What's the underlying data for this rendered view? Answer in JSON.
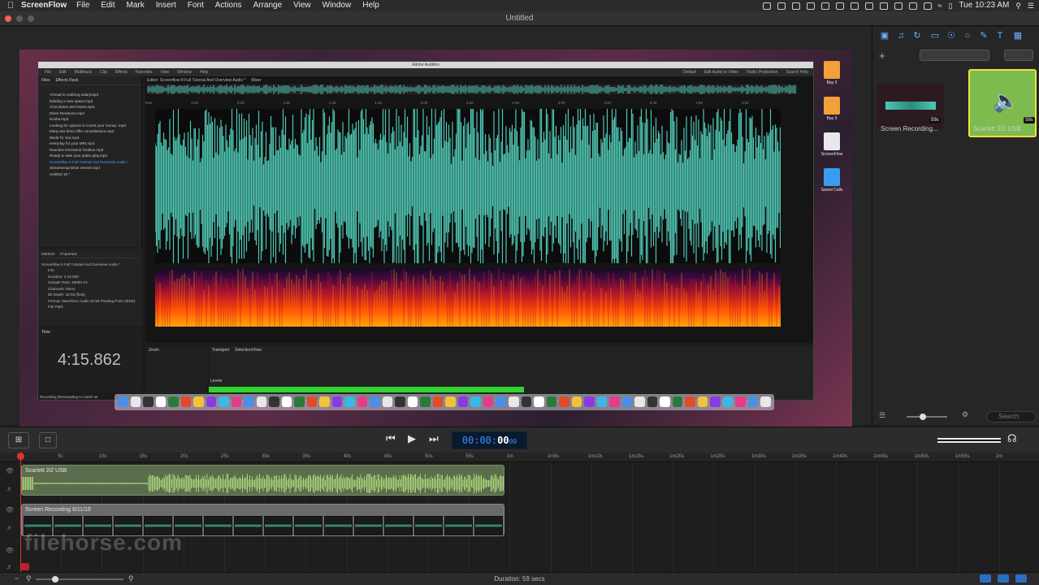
{
  "menubar": {
    "app_name": "ScreenFlow",
    "items": [
      "File",
      "Edit",
      "Mark",
      "Insert",
      "Font",
      "Actions",
      "Arrange",
      "View",
      "Window",
      "Help"
    ],
    "clock": "Tue 10:23 AM"
  },
  "window": {
    "title": "Untitled"
  },
  "recording": {
    "audition": {
      "app_title": "Adobe Audition",
      "menus": [
        "File",
        "Edit",
        "Multitrack",
        "Clip",
        "Effects",
        "Favorites",
        "View",
        "Window",
        "Help"
      ],
      "panel_files": "Files",
      "panel_effects": "Effects Rack",
      "editor_tab": "Editor: Screenflow 8 Full Tutorial And Overview Audio *",
      "mixer_tab": "Mixer",
      "workspace_items": [
        "Default",
        "Edit Audio to Video",
        "Radio Production"
      ],
      "search_placeholder": "Search Help",
      "files": [
        "Ahmad is realizing salarymp3",
        "building a new space.mp3",
        "Chocolates and Notes.mp3",
        "Elsen Revisions.mp3",
        "Knobs.mp3",
        "Looking for options to invest your money .mp3",
        "Many law firms offer consultations.mp3",
        "Meds To You.mp3",
        "everyday for your MRI.mp3",
        "Reactive Decisions Toolbox.mp3",
        "Ready to take your poker play.mp3",
        "Screenflow 8 Full Tutorial And Overview Audio *",
        "Streamwrap Brick Veneer.mp3",
        "Untitled 16 *"
      ],
      "active_file_index": 11,
      "properties_tabs": [
        "Markers",
        "Properties"
      ],
      "properties_file": "Screenflow 8 Full Tutorial And Overview Audio *",
      "properties": [
        "Info",
        "Duration: 4:15.862",
        "Sample Rate: 48000 Hz",
        "Channels: Mono",
        "Bit Depth: 32-bit (float)",
        "Format: Waveform Audio 32-bit Floating Point (IEEE)",
        "File Path:"
      ],
      "time_panel": "Time",
      "time_display": "4:15.862",
      "zoom_panel": "Zoom",
      "transport_tab": "Transport",
      "selection_tab": "Selection/View",
      "levels_label": "Levels",
      "status_left": "Recording (Resampling to match se",
      "ruler_ticks": [
        "hms",
        "0:20",
        "0:40",
        "1:00",
        "1:20",
        "1:40",
        "2:00",
        "2:20",
        "2:40",
        "3:00",
        "3:20",
        "3:40",
        "4:00",
        "4:20"
      ]
    },
    "desktop_icons": [
      "Bay 2",
      "Bay 3",
      "ScreenFlow",
      "Saved Calls"
    ]
  },
  "inspector": {
    "clips": [
      {
        "label": "Screen Recording...",
        "duration": "59s"
      },
      {
        "label": "Scarlett 2i2 USB",
        "duration": "59s"
      }
    ],
    "search_placeholder": "Search"
  },
  "timeline": {
    "timecode_prefix": "00:00:",
    "timecode_seconds": "00",
    "timecode_frames": "00",
    "ruler": [
      "0s",
      "5s",
      "10s",
      "15s",
      "20s",
      "25s",
      "30s",
      "35s",
      "40s",
      "45s",
      "50s",
      "55s",
      "1m",
      "1m5s",
      "1m10s",
      "1m15s",
      "1m20s",
      "1m25s",
      "1m30s",
      "1m35s",
      "1m40s",
      "1m45s",
      "1m50s",
      "1m55s",
      "2m"
    ],
    "tracks": [
      {
        "name": "Scarlett 2i2 USB"
      },
      {
        "name": "Screen Recording 6/11/19"
      }
    ],
    "watermark": "filehorse.com",
    "duration_text": "Duration: 59 secs"
  },
  "colors": {
    "accent": "#3d8cff",
    "playhead": "#e23232",
    "audio_clip": "#5b6d4d",
    "waveform": "#4fc7b4",
    "level_meter": "#2fd42f",
    "selected_clip_border": "#f2e23a"
  }
}
